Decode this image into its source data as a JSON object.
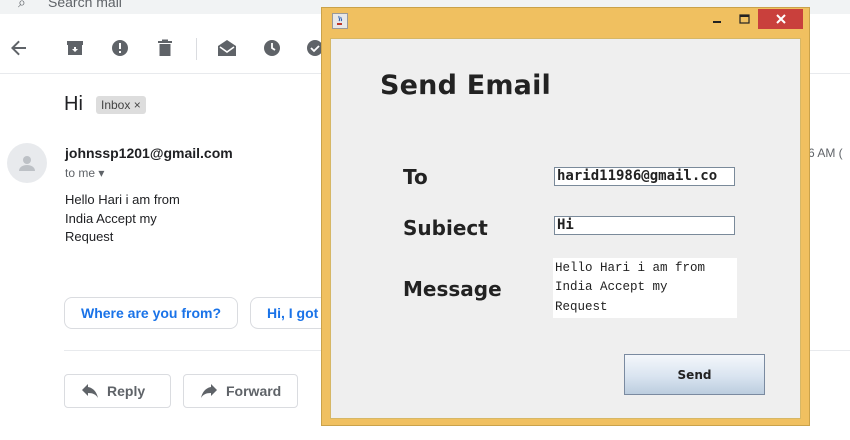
{
  "gmail": {
    "search_placeholder": "Search mail",
    "subject": "Hi",
    "inbox_chip": "Inbox ×",
    "sender": "johnssp1201@gmail.com",
    "to_me": "to me ▾",
    "time_partial": "6 AM (",
    "body_lines": [
      "Hello Hari i am from",
      "India Accept my",
      "Request"
    ],
    "smart_replies": [
      "Where are you from?",
      "Hi, I got"
    ],
    "reply_label": "Reply",
    "forward_label": "Forward",
    "toolbar_icons": [
      "back-arrow-icon",
      "archive-icon",
      "report-spam-icon",
      "delete-icon",
      "mark-unread-icon",
      "snooze-icon",
      "add-task-icon"
    ]
  },
  "java_window": {
    "title": "",
    "heading": "Send Email",
    "to_label": "To",
    "to_value": "harid11986@gmail.co",
    "subject_label": "Subiect",
    "subject_value": "Hi",
    "message_label": "Message",
    "message_value": "Hello Hari i am from\nIndia Accept my\nRequest",
    "send_label": "Send",
    "close_color": "#c9403c",
    "frame_color": "#f0c060"
  }
}
